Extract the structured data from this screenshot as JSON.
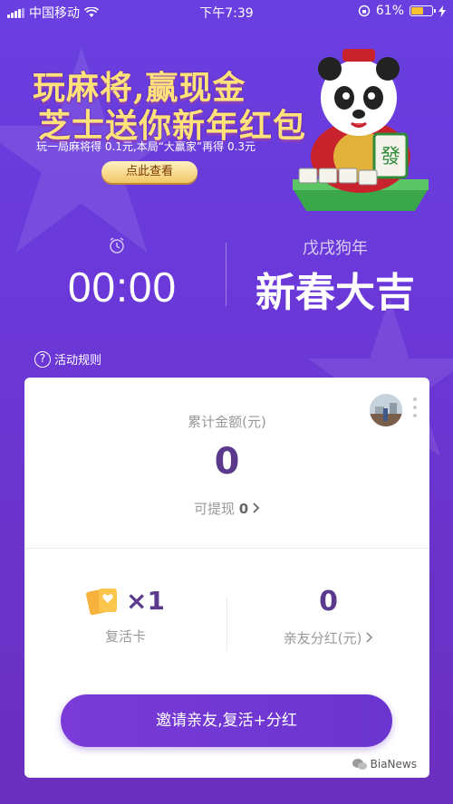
{
  "status_bar": {
    "carrier": "中国移动",
    "time": "下午7:39",
    "battery": "61%",
    "battery_level": 0.61
  },
  "banner": {
    "title_line1": "玩麻将,赢现金",
    "title_line2": "芝士送你新年红包",
    "subtitle": "玩一局麻将得 0.1元,本局“大赢家”再得 0.3元",
    "cta": "点此查看"
  },
  "timer": {
    "value": "00:00"
  },
  "year": {
    "label": "戊戌狗年",
    "greeting": "新春大吉"
  },
  "rules": {
    "icon": "question-icon",
    "label": "活动规则"
  },
  "card": {
    "total_label": "累计金额(元)",
    "total_value": "0",
    "withdraw_label": "可提现",
    "withdraw_value": "0",
    "revive_count": "×1",
    "revive_label": "复活卡",
    "bonus_value": "0",
    "bonus_label": "亲友分红(元)",
    "invite_button": "邀请亲友,复活+分红"
  },
  "watermark": "BiaNews",
  "colors": {
    "accent": "#6a34cf",
    "value": "#5b3a8e",
    "gold": "#ffe27a"
  }
}
